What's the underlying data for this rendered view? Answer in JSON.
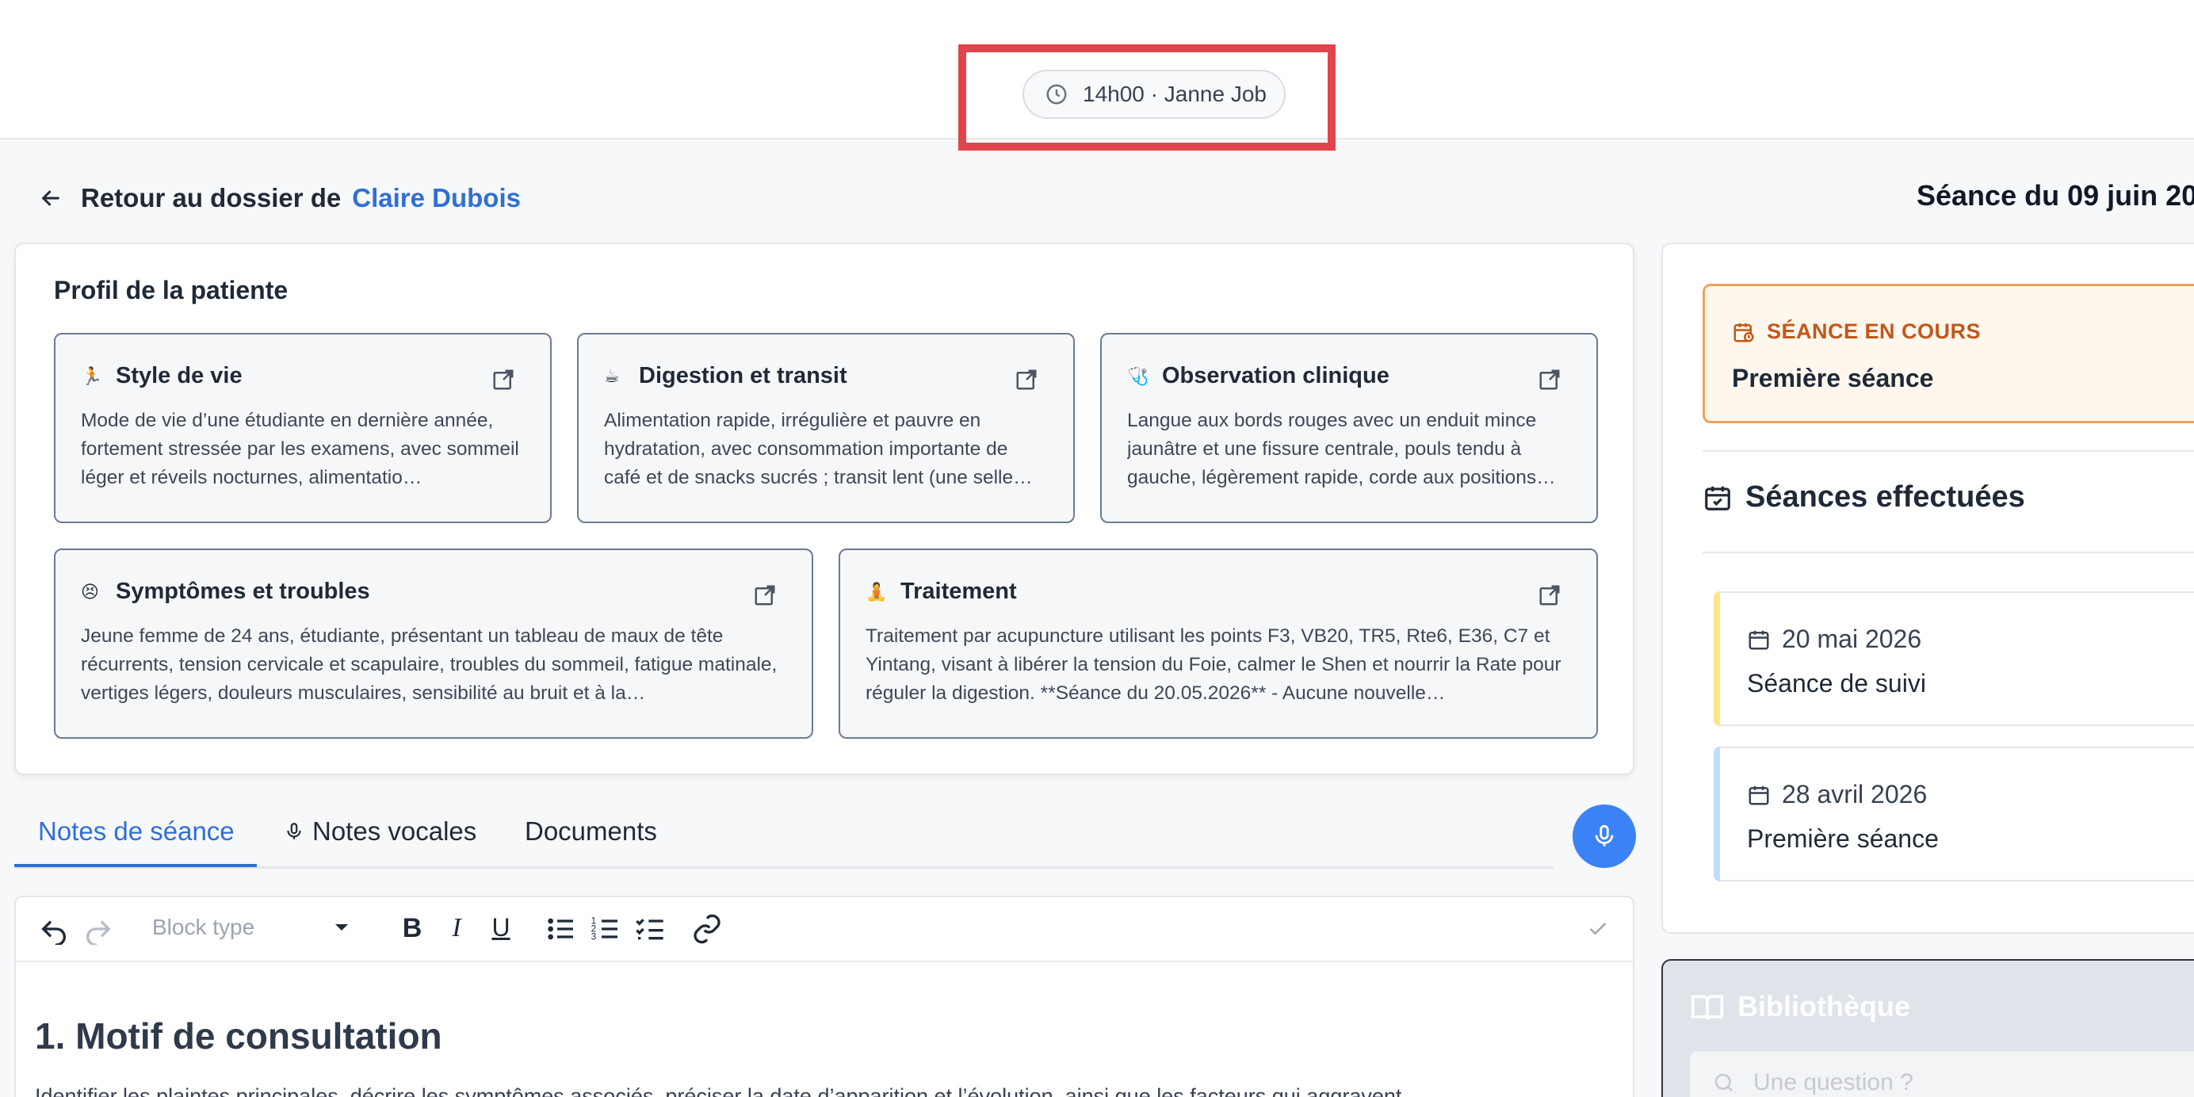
{
  "header": {
    "appointment": "14h00 · Janne Job"
  },
  "nav": {
    "back_label": "Retour au dossier de",
    "patient_name": "Claire Dubois",
    "session_title": "Séance du 09 juin 20"
  },
  "profile": {
    "title": "Profil de la patiente",
    "cards": [
      {
        "emoji": "🏃",
        "title": "Style de vie",
        "text": "Mode de vie d’une étudiante en dernière année, fortement stressée par les examens, avec sommeil léger et réveils nocturnes, alimentatio…"
      },
      {
        "emoji": "☕",
        "title": "Digestion et transit",
        "text": "Alimentation rapide, irrégulière et pauvre en hydratation, avec consommation importante de café et de snacks sucrés ; transit lent (une selle…"
      },
      {
        "emoji": "🩺",
        "title": "Observation clinique",
        "text": "Langue aux bords rouges avec un enduit mince jaunâtre et une fissure centrale, pouls tendu à gauche, légèrement rapide, corde aux positions…"
      },
      {
        "emoji": "😣",
        "title": "Symptômes et troubles",
        "text": "Jeune femme de 24 ans, étudiante, présentant un tableau de maux de tête récurrents, tension cervicale et scapulaire, troubles du sommeil, fatigue matinale, vertiges légers, douleurs musculaires, sensibilité au bruit et à la…"
      },
      {
        "emoji": "🧘",
        "title": "Traitement",
        "text": "Traitement par acupuncture utilisant les points F3, VB20, TR5, Rte6, E36, C7 et Yintang, visant à libérer la tension du Foie, calmer le Shen et nourrir la Rate pour réguler la digestion. **Séance du 20.05.2026** - Aucune nouvelle…"
      }
    ]
  },
  "tabs": [
    {
      "label": "Notes de séance",
      "active": true
    },
    {
      "label": "Notes vocales",
      "active": false
    },
    {
      "label": "Documents",
      "active": false
    }
  ],
  "editor": {
    "block_type_placeholder": "Block type",
    "heading": "1. Motif de consultation",
    "paragraph": "Identifier les plaintes principales, décrire les symptômes associés, préciser la date d’apparition et l’évolution, ainsi que les facteurs qui aggravent"
  },
  "sidebar": {
    "current": {
      "label": "SÉANCE EN COURS",
      "name": "Première séance",
      "accent": "#c2571a"
    },
    "done_title": "Séances effectuées",
    "sessions": [
      {
        "date": "20 mai 2026",
        "type": "Séance de suivi",
        "stripe": "#fde68a"
      },
      {
        "date": "28 avril 2026",
        "type": "Première séance",
        "stripe": "#bfdbfe"
      }
    ],
    "library_title": "Bibliothèque",
    "library_placeholder": "Une question ?"
  }
}
